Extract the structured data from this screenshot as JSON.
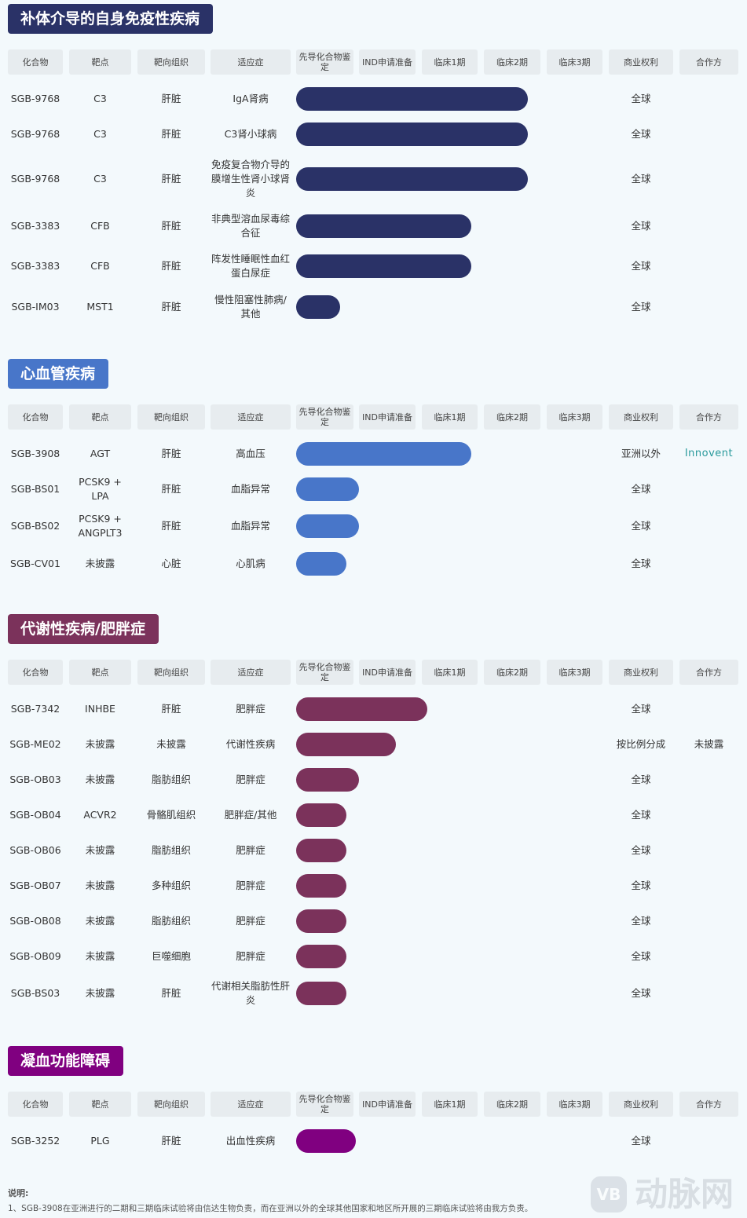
{
  "headers": [
    "化合物",
    "靶点",
    "靶向组织",
    "适应症",
    "先导化合物鉴定",
    "IND申请准备",
    "临床1期",
    "临床2期",
    "临床3期",
    "商业权利",
    "合作方"
  ],
  "phases": [
    "先导化合物鉴定",
    "IND申请准备",
    "临床1期",
    "临床2期",
    "临床3期"
  ],
  "chart_data": {
    "type": "bar",
    "orientation": "horizontal",
    "description": "Pipeline progress bars; value = stage reached (0-5 scale across the five stage columns)",
    "sections": [
      {
        "title": "补体介导的自身免疫性疾病",
        "color": "#2a3267",
        "rows": [
          {
            "compound": "SGB-9768",
            "target": "C3",
            "tissue": "肝脏",
            "indication": "IgA肾病",
            "progress": 3.7,
            "rights": "全球",
            "partner": ""
          },
          {
            "compound": "SGB-9768",
            "target": "C3",
            "tissue": "肝脏",
            "indication": "C3肾小球病",
            "progress": 3.7,
            "rights": "全球",
            "partner": ""
          },
          {
            "compound": "SGB-9768",
            "target": "C3",
            "tissue": "肝脏",
            "indication": "免疫复合物介导的膜增生性肾小球肾炎",
            "progress": 3.7,
            "rights": "全球",
            "partner": ""
          },
          {
            "compound": "SGB-3383",
            "target": "CFB",
            "tissue": "肝脏",
            "indication": "非典型溶血尿毒综合征",
            "progress": 2.8,
            "rights": "全球",
            "partner": ""
          },
          {
            "compound": "SGB-3383",
            "target": "CFB",
            "tissue": "肝脏",
            "indication": "阵发性睡眠性血红蛋白尿症",
            "progress": 2.8,
            "rights": "全球",
            "partner": ""
          },
          {
            "compound": "SGB-IM03",
            "target": "MST1",
            "tissue": "肝脏",
            "indication": "慢性阻塞性肺病/其他",
            "progress": 0.7,
            "rights": "全球",
            "partner": ""
          }
        ]
      },
      {
        "title": "心血管疾病",
        "color": "#4876c9",
        "rows": [
          {
            "compound": "SGB-3908",
            "target": "AGT",
            "tissue": "肝脏",
            "indication": "高血压",
            "progress": 2.8,
            "rights": "亚洲以外",
            "partner": "Innovent"
          },
          {
            "compound": "SGB-BS01",
            "target": "PCSK9 + LPA",
            "tissue": "肝脏",
            "indication": "血脂异常",
            "progress": 1.0,
            "rights": "全球",
            "partner": ""
          },
          {
            "compound": "SGB-BS02",
            "target": "PCSK9 + ANGPLT3",
            "tissue": "肝脏",
            "indication": "血脂异常",
            "progress": 1.0,
            "rights": "全球",
            "partner": ""
          },
          {
            "compound": "SGB-CV01",
            "target": "未披露",
            "tissue": "心脏",
            "indication": "心肌病",
            "progress": 0.8,
            "rights": "全球",
            "partner": ""
          }
        ]
      },
      {
        "title": "代谢性疾病/肥胖症",
        "color": "#7b325b",
        "rows": [
          {
            "compound": "SGB-7342",
            "target": "INHBE",
            "tissue": "肝脏",
            "indication": "肥胖症",
            "progress": 2.1,
            "rights": "全球",
            "partner": ""
          },
          {
            "compound": "SGB-ME02",
            "target": "未披露",
            "tissue": "未披露",
            "indication": "代谢性疾病",
            "progress": 1.6,
            "rights": "按比例分成",
            "partner": "未披露"
          },
          {
            "compound": "SGB-OB03",
            "target": "未披露",
            "tissue": "脂肪组织",
            "indication": "肥胖症",
            "progress": 1.0,
            "rights": "全球",
            "partner": ""
          },
          {
            "compound": "SGB-OB04",
            "target": "ACVR2",
            "tissue": "骨骼肌组织",
            "indication": "肥胖症/其他",
            "progress": 0.8,
            "rights": "全球",
            "partner": ""
          },
          {
            "compound": "SGB-OB06",
            "target": "未披露",
            "tissue": "脂肪组织",
            "indication": "肥胖症",
            "progress": 0.8,
            "rights": "全球",
            "partner": ""
          },
          {
            "compound": "SGB-OB07",
            "target": "未披露",
            "tissue": "多种组织",
            "indication": "肥胖症",
            "progress": 0.8,
            "rights": "全球",
            "partner": ""
          },
          {
            "compound": "SGB-OB08",
            "target": "未披露",
            "tissue": "脂肪组织",
            "indication": "肥胖症",
            "progress": 0.8,
            "rights": "全球",
            "partner": ""
          },
          {
            "compound": "SGB-OB09",
            "target": "未披露",
            "tissue": "巨噬细胞",
            "indication": "肥胖症",
            "progress": 0.8,
            "rights": "全球",
            "partner": ""
          },
          {
            "compound": "SGB-BS03",
            "target": "未披露",
            "tissue": "肝脏",
            "indication": "代谢相关脂肪性肝炎",
            "progress": 0.8,
            "rights": "全球",
            "partner": ""
          }
        ]
      },
      {
        "title": "凝血功能障碍",
        "color": "#800080",
        "rows": [
          {
            "compound": "SGB-3252",
            "target": "PLG",
            "tissue": "肝脏",
            "indication": "出血性疾病",
            "progress": 0.95,
            "rights": "全球",
            "partner": ""
          }
        ]
      }
    ]
  },
  "note": {
    "title": "说明:",
    "text": "1、SGB-3908在亚洲进行的二期和三期临床试验将由信达生物负责，而在亚洲以外的全球其他国家和地区所开展的三期临床试验将由我方负责。"
  },
  "watermark": {
    "badge": "VB",
    "text": "动脉网"
  }
}
